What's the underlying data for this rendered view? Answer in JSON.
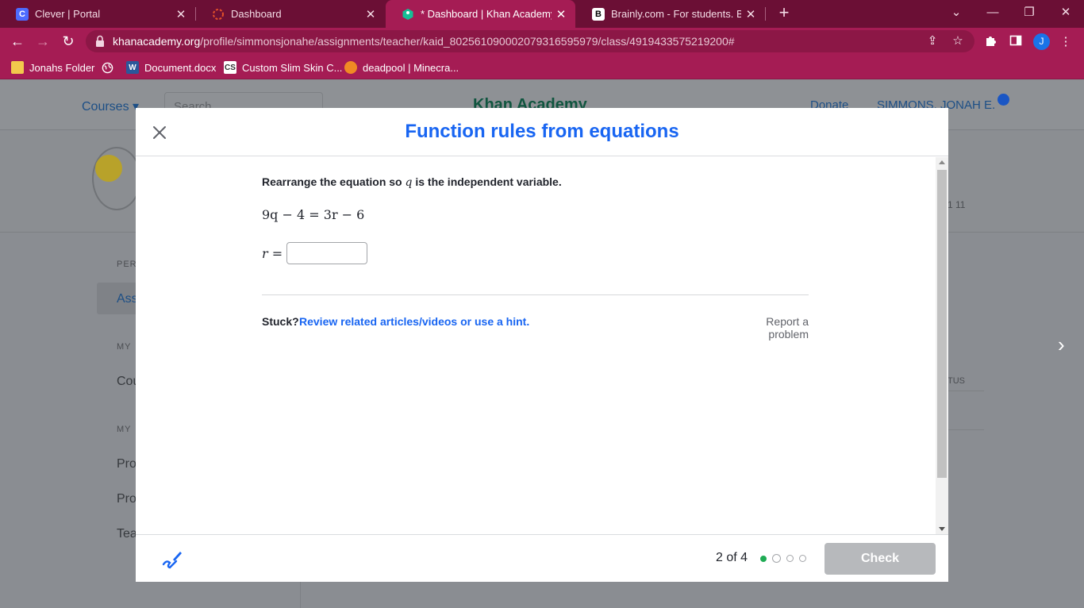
{
  "browser": {
    "tabs": [
      {
        "title": "Clever | Portal",
        "favicon": "clever-icon",
        "active": false
      },
      {
        "title": "Dashboard",
        "favicon": "dashboard-icon",
        "active": false
      },
      {
        "title": "* Dashboard | Khan Academy",
        "favicon": "khan-academy-icon",
        "active": true
      },
      {
        "title": "Brainly.com - For students. By stu",
        "favicon": "brainly-icon",
        "active": false
      }
    ],
    "url_domain": "khanacademy.org",
    "url_path": "/profile/simmonsjonahe/assignments/teacher/kaid_802561090002079316595979/class/4919433575219200#",
    "profile_initial": "J",
    "bookmarks": [
      {
        "label": "Jonahs Folder",
        "icon": "folder-icon"
      },
      {
        "label": "",
        "icon": "globe-icon"
      },
      {
        "label": "Document.docx",
        "icon": "word-icon"
      },
      {
        "label": "Custom Slim Skin C...",
        "icon": "cs-icon"
      },
      {
        "label": "deadpool | Minecra...",
        "icon": "pumpkin-icon"
      }
    ]
  },
  "background_page": {
    "courses": "Courses ▾",
    "search_placeholder": "Search",
    "logo": "Khan Academy",
    "donate": "Donate",
    "user": "SIMMONS, JONAH E.",
    "stats": "1  11",
    "left_labels": [
      "PER",
      "Ass",
      "MY",
      "Cou",
      "MY",
      "Pro",
      "Pro",
      "Tea"
    ],
    "col_header": "TUS"
  },
  "modal": {
    "title": "Function rules from equations",
    "question_before": "Rearrange the equation so ",
    "question_var": "q",
    "question_after": " is the independent variable.",
    "equation": "9q − 4 = 3r − 6",
    "answer_label": "r =",
    "answer_value": "",
    "stuck_label": "Stuck?",
    "hint_link": "Review related articles/videos or use a hint.",
    "report_link": "Report a problem",
    "progress_text": "2 of 4",
    "progress": {
      "completed": 1,
      "current": 2,
      "total": 4
    },
    "check_label": "Check"
  },
  "colors": {
    "tab_strip": "#6b0f35",
    "toolbar": "#a51c54",
    "ka_blue": "#1865f2",
    "progress_green": "#1fab54",
    "check_disabled": "#b7b9bc"
  }
}
